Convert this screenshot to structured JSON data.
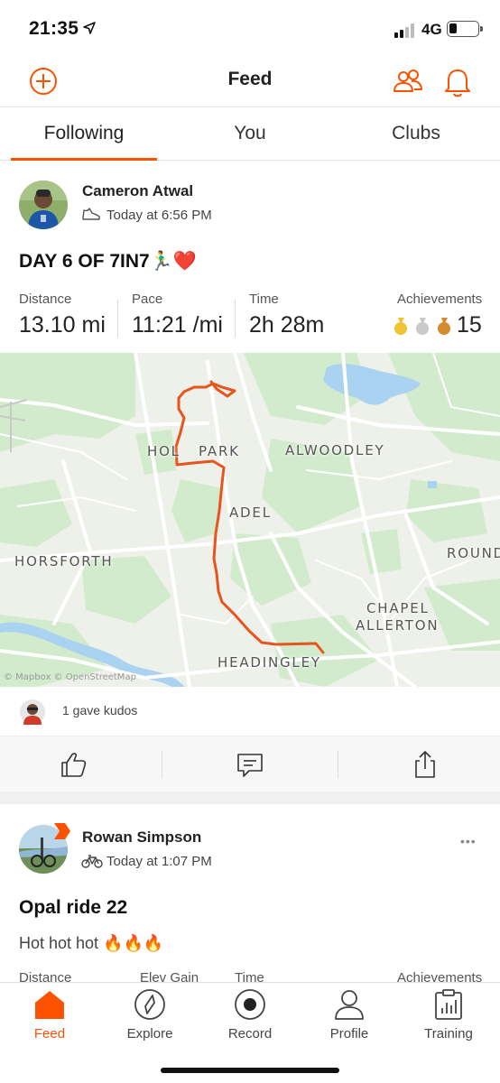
{
  "status_bar": {
    "time": "21:35",
    "network": "4G"
  },
  "header": {
    "title": "Feed"
  },
  "tabs": [
    {
      "label": "Following",
      "active": true
    },
    {
      "label": "You",
      "active": false
    },
    {
      "label": "Clubs",
      "active": false
    }
  ],
  "activity1": {
    "athlete": "Cameron Atwal",
    "timestamp": "Today at 6:56 PM",
    "activity_type_icon": "shoe-icon",
    "title": "DAY 6 OF 7IN7🏃‍♂️❤️",
    "stats": [
      {
        "label": "Distance",
        "value": "13.10 mi"
      },
      {
        "label": "Pace",
        "value": "11:21 /mi"
      },
      {
        "label": "Time",
        "value": "2h 28m"
      }
    ],
    "achievements": {
      "label": "Achievements",
      "count": "15",
      "medals": [
        "gold",
        "silver",
        "bronze"
      ]
    },
    "map": {
      "place_labels": [
        "HOL",
        "PARK",
        "ALWOODLEY",
        "ADEL",
        "HORSFORTH",
        "ROUND",
        "CHAPEL",
        "ALLERTON",
        "HEADINGLEY"
      ],
      "attribution": "© Mapbox © OpenStreetMap"
    },
    "kudos_text": "1 gave kudos"
  },
  "activity2": {
    "athlete": "Rowan Simpson",
    "timestamp": "Today at 1:07 PM",
    "activity_type_icon": "bike-icon",
    "title": "Opal ride 22",
    "description": "Hot hot hot 🔥🔥🔥",
    "stat_labels": [
      "Distance",
      "Elev Gain",
      "Time",
      "Achievements"
    ],
    "more": "•••"
  },
  "tab_bar": [
    {
      "label": "Feed",
      "icon": "home-icon",
      "active": true
    },
    {
      "label": "Explore",
      "icon": "compass-icon",
      "active": false
    },
    {
      "label": "Record",
      "icon": "record-icon",
      "active": false
    },
    {
      "label": "Profile",
      "icon": "person-icon",
      "active": false
    },
    {
      "label": "Training",
      "icon": "training-chart-icon",
      "active": false
    }
  ],
  "colors": {
    "accent": "#fc5200",
    "route": "#e8541e",
    "water": "#a9d3f0",
    "green": "#d2ebcc"
  }
}
